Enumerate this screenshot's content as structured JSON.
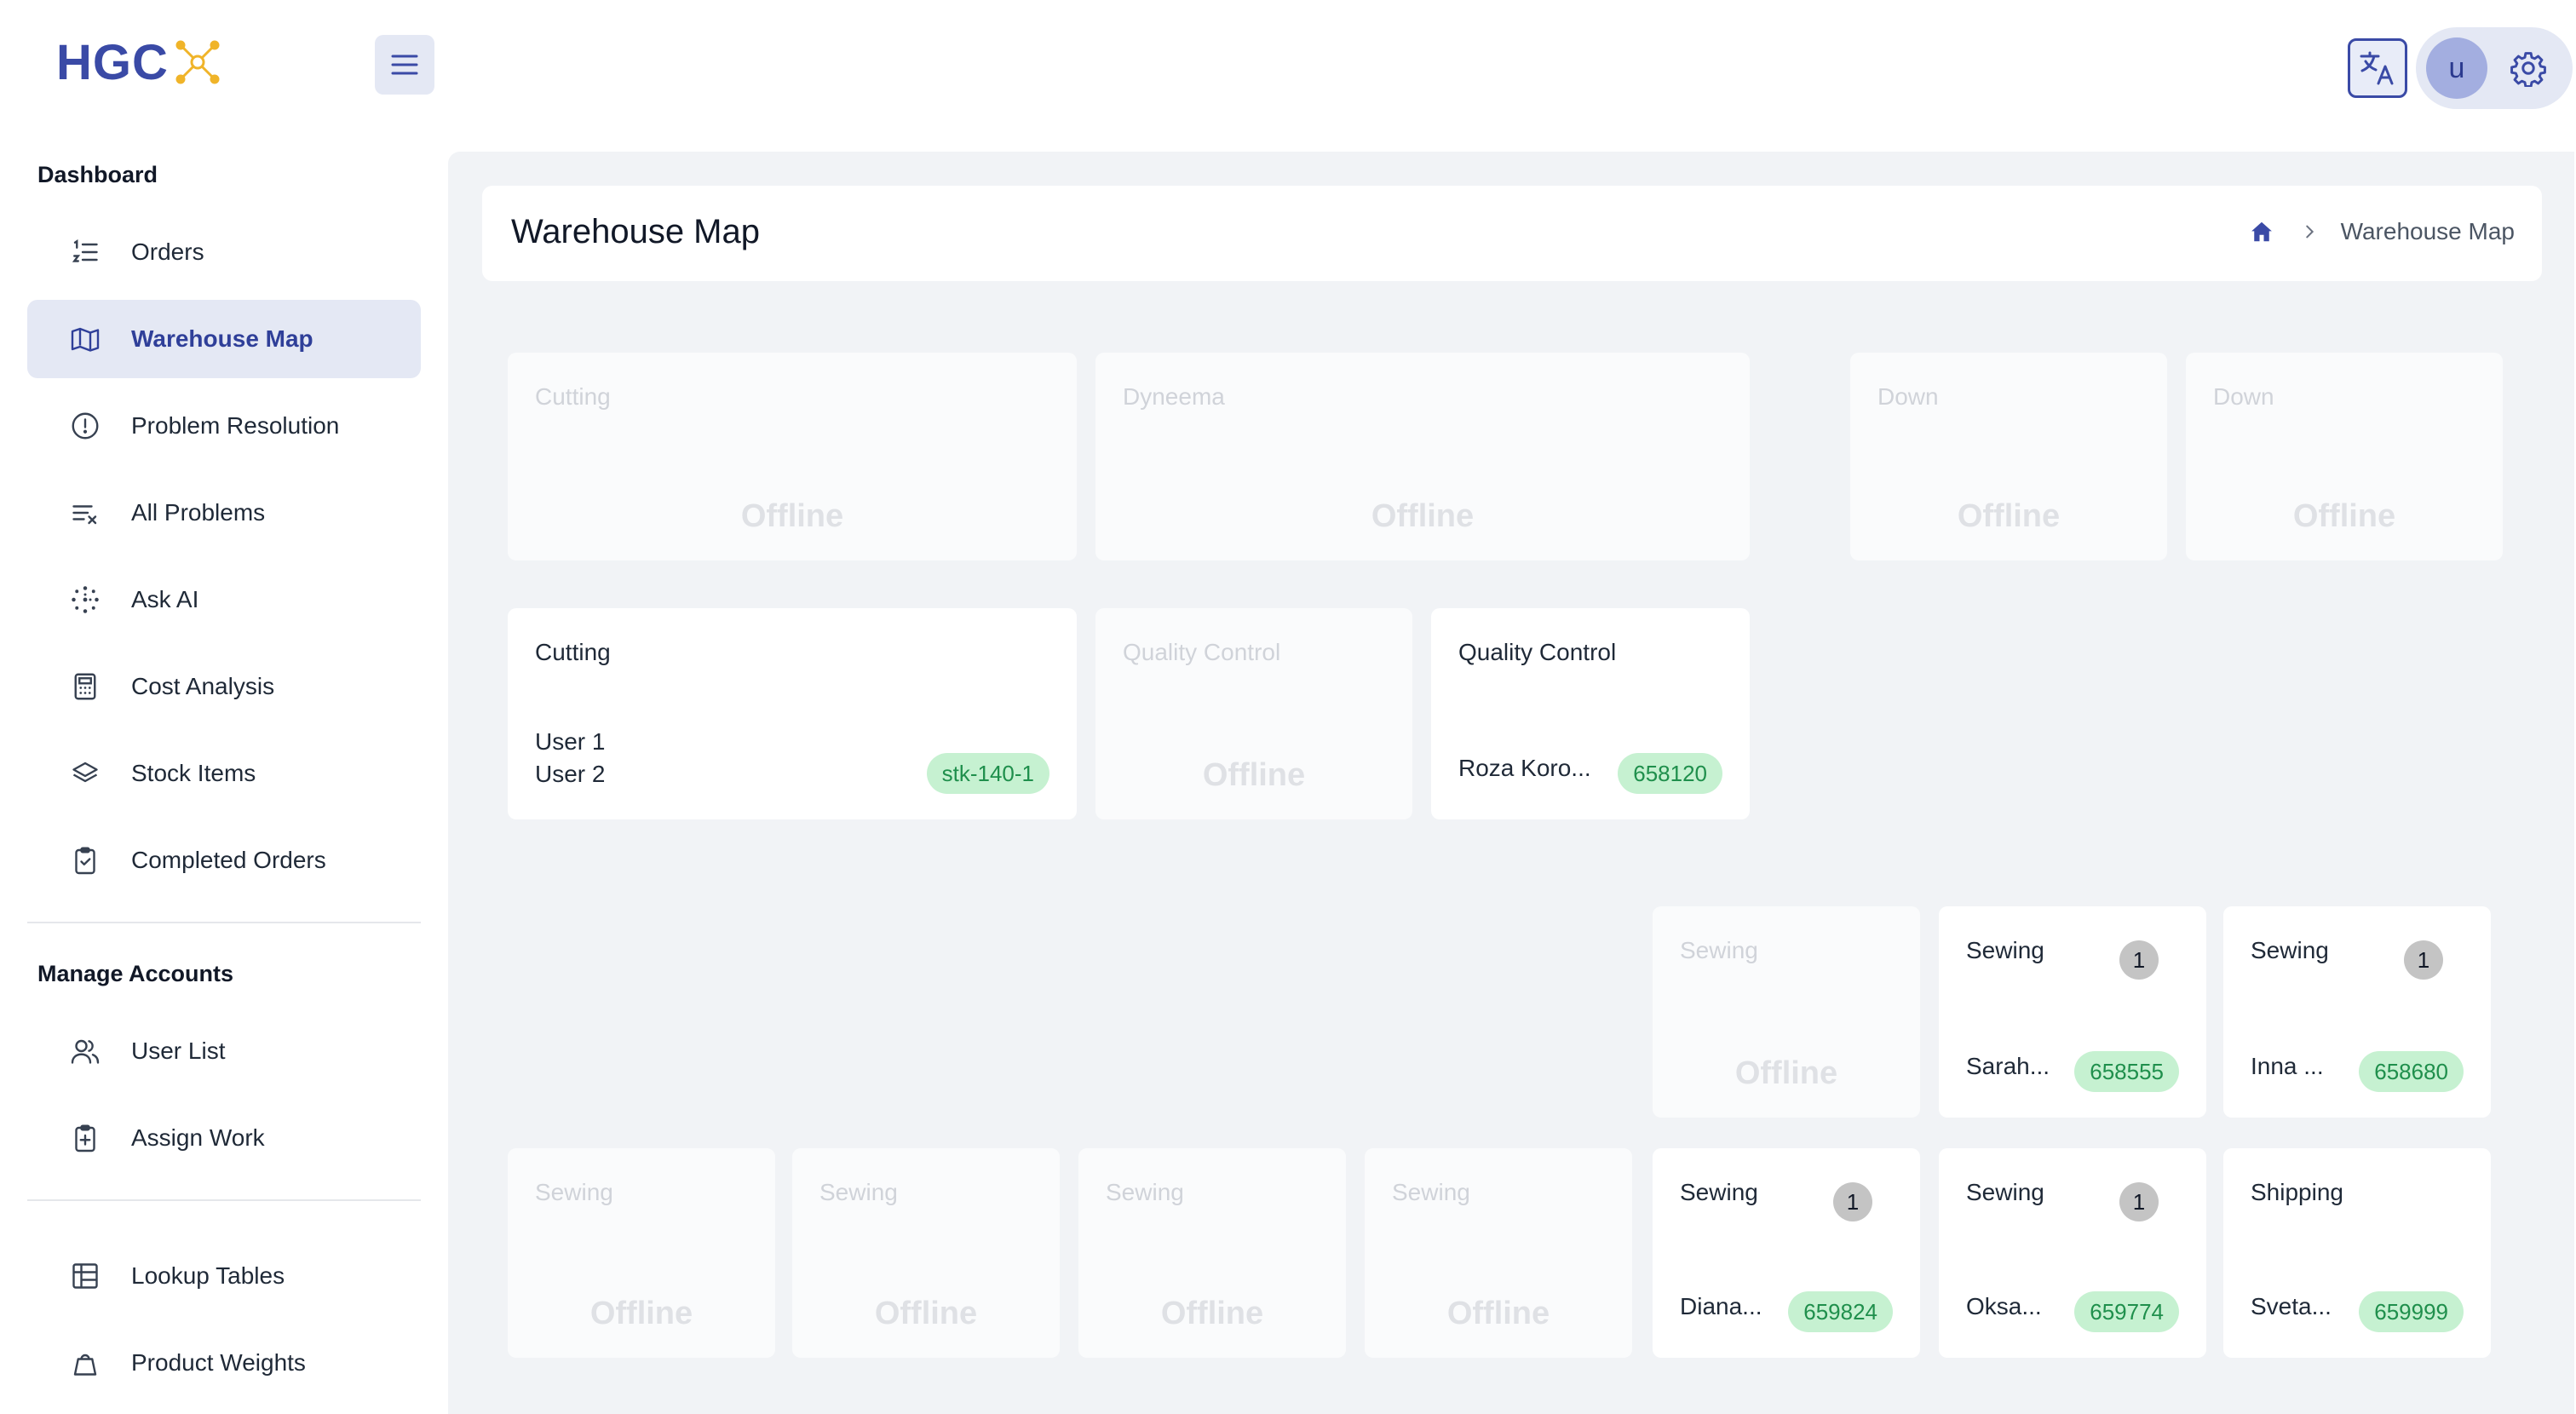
{
  "app": {
    "logo_text": "HGC"
  },
  "header": {
    "avatar_initial": "u"
  },
  "sidebar": {
    "sections": [
      {
        "title": "Dashboard"
      },
      {
        "title": "Manage Accounts"
      }
    ],
    "items": [
      {
        "label": "Orders",
        "icon": "ordered-list-icon"
      },
      {
        "label": "Warehouse Map",
        "icon": "map-icon",
        "active": true
      },
      {
        "label": "Problem Resolution",
        "icon": "alert-circle-icon"
      },
      {
        "label": "All Problems",
        "icon": "list-clear-icon"
      },
      {
        "label": "Ask AI",
        "icon": "sparkle-dots-icon"
      },
      {
        "label": "Cost Analysis",
        "icon": "calculator-icon"
      },
      {
        "label": "Stock Items",
        "icon": "layers-icon"
      },
      {
        "label": "Completed Orders",
        "icon": "clipboard-check-icon"
      },
      {
        "label": "User List",
        "icon": "users-icon"
      },
      {
        "label": "Assign Work",
        "icon": "clipboard-plus-icon"
      },
      {
        "label": "Lookup Tables",
        "icon": "table-icon"
      },
      {
        "label": "Product Weights",
        "icon": "weight-icon"
      }
    ]
  },
  "page": {
    "title": "Warehouse Map",
    "breadcrumb": {
      "current": "Warehouse Map"
    }
  },
  "offline_label": "Offline",
  "stations": [
    {
      "name": "Cutting",
      "status": "offline"
    },
    {
      "name": "Dyneema",
      "status": "offline"
    },
    {
      "name": "Down",
      "status": "offline"
    },
    {
      "name": "Down",
      "status": "offline"
    },
    {
      "name": "Cutting",
      "status": "online",
      "users": [
        "User 1",
        "User 2"
      ],
      "tag": "stk-140-1"
    },
    {
      "name": "Quality Control",
      "status": "offline"
    },
    {
      "name": "Quality Control",
      "status": "online",
      "worker": "Roza Koro...",
      "tag": "658120"
    },
    {
      "name": "Sewing",
      "status": "offline"
    },
    {
      "name": "Sewing",
      "status": "online",
      "count": "1",
      "worker": "Sarah...",
      "tag": "658555"
    },
    {
      "name": "Sewing",
      "status": "online",
      "count": "1",
      "worker": "Inna ...",
      "tag": "658680"
    },
    {
      "name": "Sewing",
      "status": "offline"
    },
    {
      "name": "Sewing",
      "status": "offline"
    },
    {
      "name": "Sewing",
      "status": "offline"
    },
    {
      "name": "Sewing",
      "status": "offline"
    },
    {
      "name": "Sewing",
      "status": "online",
      "count": "1",
      "worker": "Diana...",
      "tag": "659824"
    },
    {
      "name": "Sewing",
      "status": "online",
      "count": "1",
      "worker": "Oksa...",
      "tag": "659774"
    },
    {
      "name": "Shipping",
      "status": "online",
      "worker": "Sveta...",
      "tag": "659999"
    }
  ],
  "colors": {
    "brand": "#3a4aa6",
    "accent_logo": "#f0b429",
    "active_bg": "#e4e8f4",
    "tag_bg": "#c6f1d1",
    "tag_text": "#1f8f4c",
    "main_bg": "#f1f3f6"
  }
}
